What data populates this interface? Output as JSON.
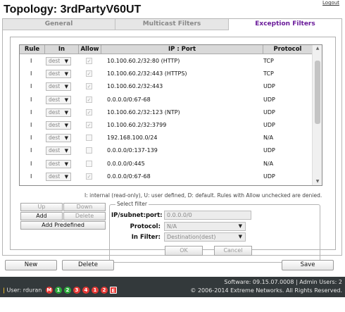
{
  "header": {
    "logout": "Logout",
    "title": "Topology: 3rdPartyV60UT"
  },
  "tabs": [
    {
      "label": "General",
      "active": false
    },
    {
      "label": "Multicast Filters",
      "active": false
    },
    {
      "label": "Exception Filters",
      "active": true
    }
  ],
  "table": {
    "columns": [
      "Rule",
      "In",
      "Allow",
      "IP : Port",
      "Protocol"
    ],
    "rows": [
      {
        "rule": "I",
        "in": "dest",
        "allow": true,
        "ip_port": "10.100.60.2/32:80 (HTTP)",
        "protocol": "TCP"
      },
      {
        "rule": "I",
        "in": "dest",
        "allow": true,
        "ip_port": "10.100.60.2/32:443 (HTTPS)",
        "protocol": "TCP"
      },
      {
        "rule": "I",
        "in": "dest",
        "allow": true,
        "ip_port": "10.100.60.2/32:443",
        "protocol": "UDP"
      },
      {
        "rule": "I",
        "in": "dest",
        "allow": true,
        "ip_port": "0.0.0.0/0:67-68",
        "protocol": "UDP"
      },
      {
        "rule": "I",
        "in": "dest",
        "allow": true,
        "ip_port": "10.100.60.2/32:123 (NTP)",
        "protocol": "UDP"
      },
      {
        "rule": "I",
        "in": "dest",
        "allow": true,
        "ip_port": "10.100.60.2/32:3799",
        "protocol": "UDP"
      },
      {
        "rule": "I",
        "in": "dest",
        "allow": false,
        "ip_port": "192.168.100.0/24",
        "protocol": "N/A"
      },
      {
        "rule": "I",
        "in": "dest",
        "allow": false,
        "ip_port": "0.0.0.0/0:137-139",
        "protocol": "UDP"
      },
      {
        "rule": "I",
        "in": "dest",
        "allow": false,
        "ip_port": "0.0.0.0/0:445",
        "protocol": "N/A"
      },
      {
        "rule": "I",
        "in": "dest",
        "allow": true,
        "ip_port": "0.0.0.0/0:67-68",
        "protocol": "UDP"
      }
    ],
    "dropdown_arrow": "▼",
    "check_glyph": "✓"
  },
  "legend_text": "I: internal (read-only), U: user defined, D: default. Rules with Allow unchecked are denied.",
  "rule_buttons": {
    "up": "Up",
    "down": "Down",
    "add": "Add",
    "delete": "Delete",
    "add_predefined": "Add Predefined"
  },
  "select_filter": {
    "legend": "Select filter",
    "ip_label": "IP/subnet:port:",
    "ip_value": "0.0.0.0/0",
    "protocol_label": "Protocol:",
    "protocol_value": "N/A",
    "in_filter_label": "In Filter:",
    "in_filter_value": "Destination(dest)",
    "ok": "OK",
    "cancel": "Cancel"
  },
  "bottom_buttons": {
    "new": "New",
    "delete": "Delete",
    "save": "Save"
  },
  "footer": {
    "user": "User: rduran",
    "badges": [
      {
        "label": "M",
        "color": "#e53935",
        "shape": "circle"
      },
      {
        "label": "1",
        "color": "#2eaa3c",
        "shape": "circle"
      },
      {
        "label": "2",
        "color": "#2eaa3c",
        "shape": "circle"
      },
      {
        "label": "3",
        "color": "#e53935",
        "shape": "circle"
      },
      {
        "label": "4",
        "color": "#e53935",
        "shape": "circle"
      },
      {
        "label": "1",
        "color": "#e53935",
        "shape": "circle"
      },
      {
        "label": "2",
        "color": "#e53935",
        "shape": "circle"
      },
      {
        "label": "E",
        "color": "#e53935",
        "shape": "square"
      }
    ],
    "software": "Software: 09.15.07.0008 | Admin Users: 2",
    "copyright": "© 2006-2014  Extreme Networks. All Rights Reserved."
  },
  "colors": {
    "active_tab": "#6a1b9a",
    "footer_bg": "#33393b"
  }
}
